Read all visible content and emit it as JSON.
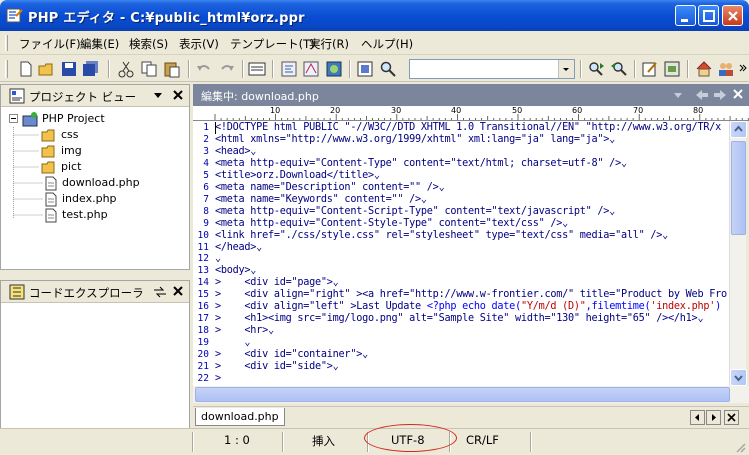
{
  "window": {
    "title": "PHP エディタ - C:¥public_html¥orz.ppr",
    "colors": {
      "titlebar": "#0a4ed3",
      "editor_header": "#7b869c",
      "annotation": "#d2281e"
    }
  },
  "menu": [
    "ファイル(F)",
    "編集(E)",
    "検索(S)",
    "表示(V)",
    "テンプレート(T)",
    "実行(R)",
    "ヘルプ(H)"
  ],
  "toolbar": {
    "icons": [
      "new-file-icon",
      "open-folder-icon",
      "save-icon",
      "save-all-icon",
      "cut-icon",
      "copy-icon",
      "paste-icon",
      "undo-icon",
      "redo-icon",
      "view-icon",
      "template-icon",
      "format-icon",
      "browser-icon",
      "preview-icon",
      "find-icon",
      "find-next-icon",
      "find-prev-icon",
      "edit-icon",
      "settings-icon",
      "home-icon",
      "users-icon"
    ],
    "search_value": ""
  },
  "project_panel": {
    "title": "プロジェクト ビュー",
    "tree": [
      {
        "label": "PHP Project",
        "icon": "project-icon"
      },
      {
        "label": "css",
        "icon": "folder-icon"
      },
      {
        "label": "img",
        "icon": "folder-icon"
      },
      {
        "label": "pict",
        "icon": "folder-icon"
      },
      {
        "label": "download.php",
        "icon": "file-icon"
      },
      {
        "label": "index.php",
        "icon": "file-icon"
      },
      {
        "label": "test.php",
        "icon": "file-icon"
      }
    ]
  },
  "code_panel": {
    "title": "コードエクスプローラ"
  },
  "editor": {
    "header": "編集中: download.php",
    "ruler": [
      "10",
      "20",
      "30",
      "40",
      "50",
      "60",
      "70",
      "80"
    ],
    "lines": [
      {
        "n": "1",
        "t": "<!DOCTYPE html PUBLIC \"-//W3C//DTD XHTML 1.0 Transitional//EN\" \"http://www.w3.org/TR/x"
      },
      {
        "n": "2",
        "t": "<html xmlns=\"http://www.w3.org/1999/xhtml\" xml:lang=\"ja\" lang=\"ja\">⌄"
      },
      {
        "n": "3",
        "t": "<head>⌄"
      },
      {
        "n": "4",
        "t": "<meta http-equiv=\"Content-Type\" content=\"text/html; charset=utf-8\" />⌄"
      },
      {
        "n": "5",
        "t": "<title>orz.Download</title>⌄"
      },
      {
        "n": "6",
        "t": "<meta name=\"Description\" content=\"\" />⌄"
      },
      {
        "n": "7",
        "t": "<meta name=\"Keywords\" content=\"\" />⌄"
      },
      {
        "n": "8",
        "t": "<meta http-equiv=\"Content-Script-Type\" content=\"text/javascript\" />⌄"
      },
      {
        "n": "9",
        "t": "<meta http-equiv=\"Content-Style-Type\" content=\"text/css\" />⌄"
      },
      {
        "n": "10",
        "t": "<link href=\"./css/style.css\" rel=\"stylesheet\" type=\"text/css\" media=\"all\" />⌄"
      },
      {
        "n": "11",
        "t": "</head>⌄"
      },
      {
        "n": "12",
        "t": "⌄"
      },
      {
        "n": "13",
        "t": "<body>⌄"
      },
      {
        "n": "14",
        "t": ">    <div id=\"page\">⌄"
      },
      {
        "n": "15",
        "t": ">    <div align=\"right\" ><a href=\"http://www.w-frontier.com/\" title=\"Product by Web Fro"
      },
      {
        "n": "16",
        "t": ">    <div align=\"left\" >Last Update ",
        "php": "<?php echo date(",
        "str": "\"Y/m/d (D)\"",
        "t2": ",filemtime(",
        "str2": "'index.php'",
        "t3": ")"
      },
      {
        "n": "17",
        "t": ">    <h1><img src=\"img/logo.png\" alt=\"Sample Site\" width=\"130\" height=\"65\" /></h1>⌄"
      },
      {
        "n": "18",
        "t": ">    <hr>⌄"
      },
      {
        "n": "19",
        "t": "     ⌄"
      },
      {
        "n": "20",
        "t": ">    <div id=\"container\">⌄"
      },
      {
        "n": "21",
        "t": ">    <div id=\"side\">⌄"
      },
      {
        "n": "22",
        "t": ">"
      }
    ]
  },
  "tabs": {
    "active": "download.php"
  },
  "status": {
    "position": "1 : 0",
    "mode": "挿入",
    "encoding": "UTF-8",
    "newline": "CR/LF"
  }
}
